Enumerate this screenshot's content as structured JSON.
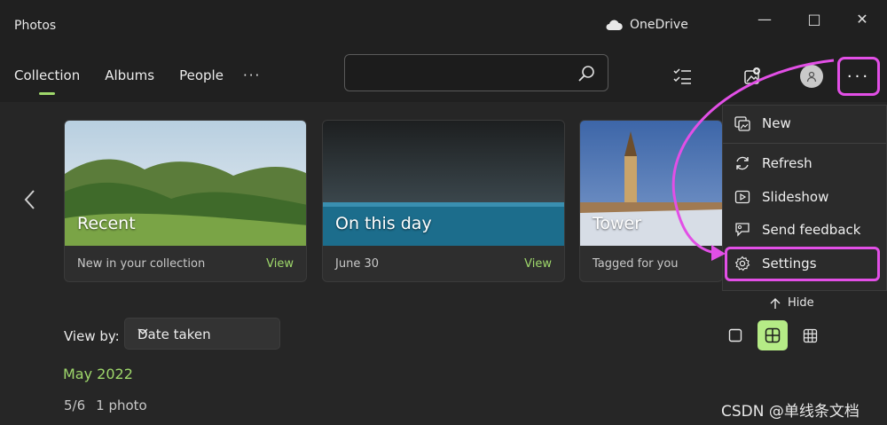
{
  "app": {
    "title": "Photos",
    "onedrive_label": "OneDrive"
  },
  "window_controls": {
    "minimize": "—",
    "maximize": "□",
    "close": "✕"
  },
  "nav": {
    "tabs": [
      "Collection",
      "Albums",
      "People"
    ],
    "active_tab": "Collection",
    "more": "···"
  },
  "search": {
    "placeholder": "",
    "value": ""
  },
  "toolbar": {
    "more_label": "···"
  },
  "cards": [
    {
      "title": "Recent",
      "subtitle": "New in your collection",
      "action": "View"
    },
    {
      "title": "On this day",
      "subtitle": "June 30",
      "action": "View"
    },
    {
      "title": "Tower",
      "subtitle": "Tagged for you",
      "action": ""
    }
  ],
  "menu": {
    "items": [
      {
        "label": "New",
        "icon": "new-album-icon"
      },
      {
        "label": "Refresh",
        "icon": "refresh-icon"
      },
      {
        "label": "Slideshow",
        "icon": "slideshow-icon"
      },
      {
        "label": "Send feedback",
        "icon": "feedback-icon"
      },
      {
        "label": "Settings",
        "icon": "gear-icon"
      }
    ],
    "highlight": "Settings"
  },
  "hide_label": "Hide",
  "view_by": {
    "label": "View by:",
    "selected": "Date taken"
  },
  "group": {
    "month": "May 2022",
    "date": "5/6",
    "count": "1 photo"
  },
  "watermark": "CSDN @单线条文档",
  "colors": {
    "accent": "#9fd86b",
    "highlight": "#e24fe6",
    "background": "#202020"
  }
}
